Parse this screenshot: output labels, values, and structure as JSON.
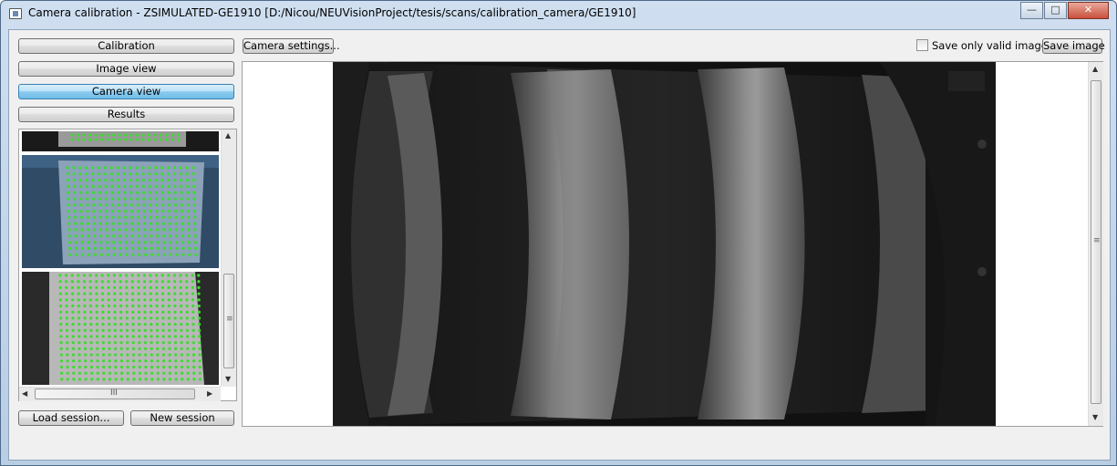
{
  "window": {
    "title": "Camera calibration - ZSIMULATED-GE1910 [D:/Nicou/NEUVisionProject/tesis/scans/calibration_camera/GE1910]",
    "minimize": "—",
    "maximize": "□",
    "close": "✕"
  },
  "sidebar": {
    "calibration": "Calibration",
    "image_view": "Image view",
    "camera_view": "Camera view",
    "results": "Results",
    "load_session": "Load session...",
    "new_session": "New session"
  },
  "toolbar": {
    "camera_settings": "Camera settings...",
    "save_only_valid": "Save only valid images",
    "save_only_valid_checked": false,
    "save_image": "Save image"
  },
  "scroll": {
    "grip": "≡",
    "hgrip": "III",
    "up": "▲",
    "down": "▼",
    "left": "◀",
    "right": "▶"
  },
  "icons": [
    "app-icon",
    "minimize-icon",
    "maximize-icon",
    "close-icon",
    "checkbox-icon"
  ]
}
